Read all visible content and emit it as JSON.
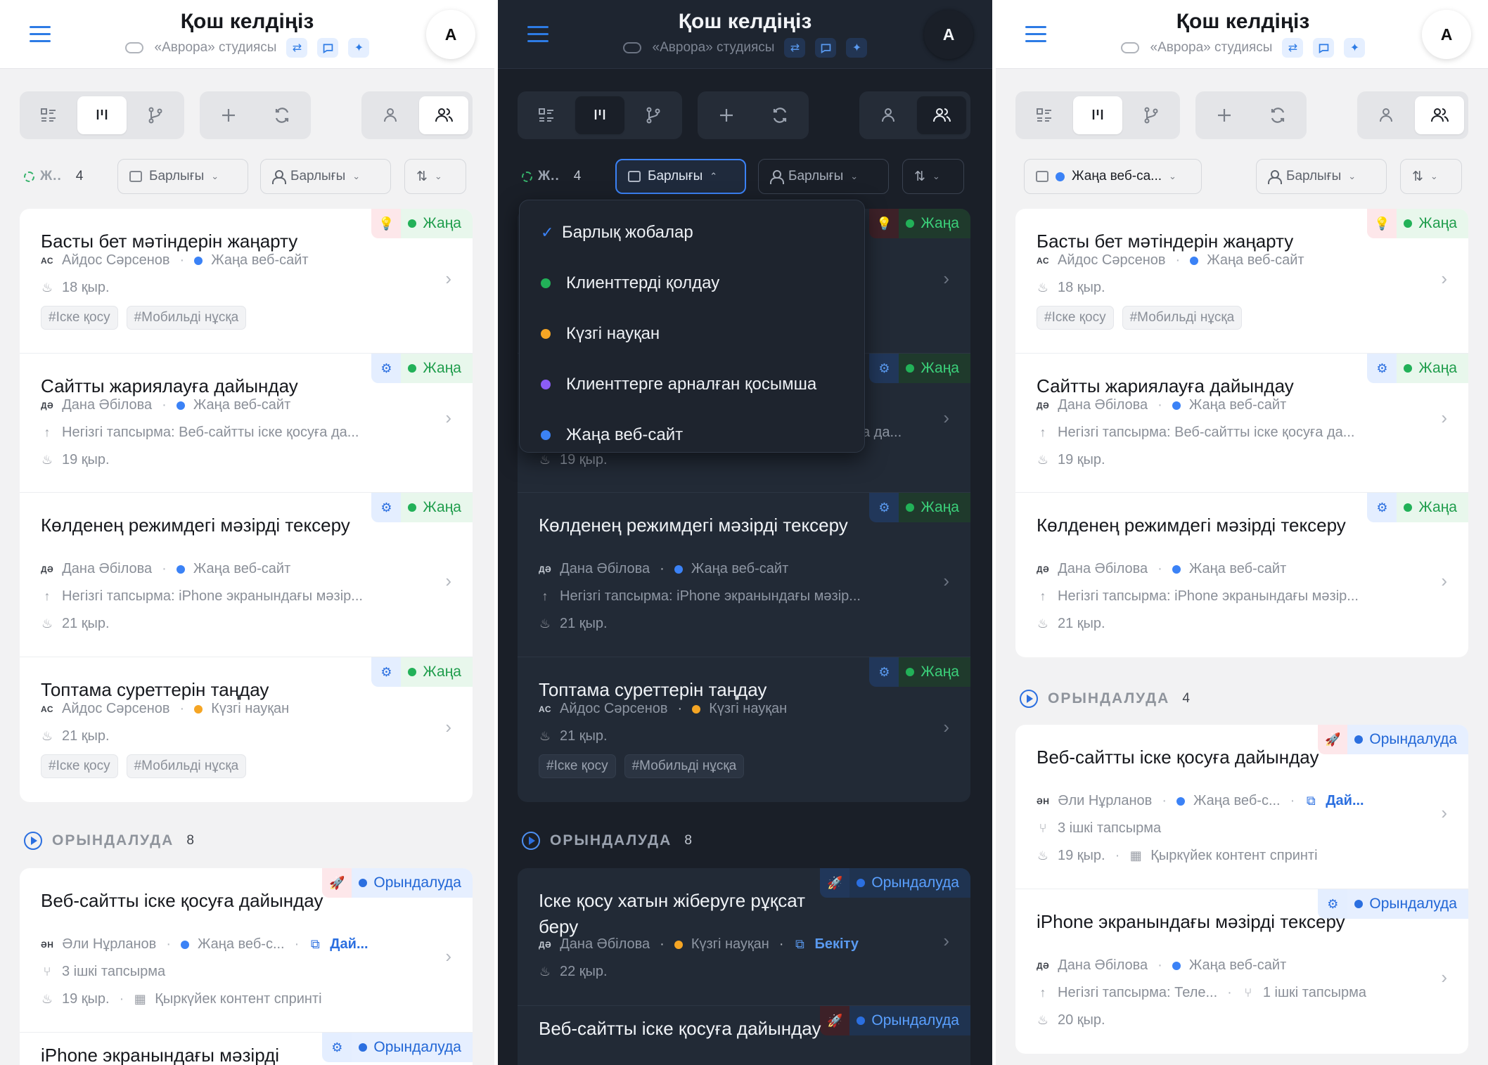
{
  "header": {
    "title": "Қош келдіңіз",
    "subtitle": "«Аврора» студиясы",
    "avatar": "A"
  },
  "status_label": "Ж..",
  "status_count": "4",
  "filters": {
    "project": "Барлығы",
    "assignee": "Барлығы",
    "project_selected": "Жаңа веб-са..."
  },
  "section_progress": {
    "label": "ОРЫНДАЛУДА",
    "count_left": "8",
    "count_right": "4"
  },
  "badges": {
    "new": "Жаңа",
    "progress": "Орындалуда"
  },
  "colors": {
    "accent": "#2d7be5",
    "green": "#22b158",
    "orange": "#f5a524",
    "purple": "#8b5cf6",
    "blue": "#3b82f6"
  },
  "dropdown": {
    "items": [
      "Барлық жобалар",
      "Клиенттерді қолдау",
      "Күзгі науқан",
      "Клиенттерге арналған қосымша",
      "Жаңа веб-сайт"
    ]
  },
  "cards": {
    "c1": {
      "title": "Басты бет мәтіндерін жаңарту",
      "initials": "АС",
      "assignee": "Айдос Сәрсенов",
      "project": "Жаңа веб-сайт",
      "date": "18 қыр.",
      "tags": [
        "#Іске қосу",
        "#Мобильді нұсқа"
      ]
    },
    "c2": {
      "title": "Сайтты жариялауға дайындау",
      "initials": "ДӘ",
      "assignee": "Дана Әбілова",
      "project": "Жаңа веб-сайт",
      "parent": "Негізгі тапсырма: Веб-сайтты іске қосуға да...",
      "date": "19 қыр."
    },
    "c3": {
      "title": "Көлденең режимдегі мәзірді тексеру",
      "initials": "ДӘ",
      "assignee": "Дана Әбілова",
      "project": "Жаңа веб-сайт",
      "parent": "Негізгі тапсырма: iPhone экранындағы мәзір...",
      "date": "21 қыр."
    },
    "c4": {
      "title": "Топтама суреттерін таңдау",
      "initials": "АС",
      "assignee": "Айдос Сәрсенов",
      "project": "Күзгі науқан",
      "date": "21 қыр.",
      "tags": [
        "#Іске қосу",
        "#Мобильді нұсқа"
      ]
    },
    "c5": {
      "title": "Веб-сайтты іске қосуға дайындау",
      "initials": "ӘН",
      "assignee": "Әли Нұрланов",
      "project": "Жаңа веб-с...",
      "link": "Дай...",
      "subtasks": "3 ішкі тапсырма",
      "date": "19 қыр.",
      "sprint": "Қыркүйек контент спринті"
    },
    "c6": {
      "title": "iPhone экранындағы мәзірді тексеру",
      "initials": "ДӘ",
      "assignee": "Дана Әбілова",
      "project": "Жаңа веб-сайт",
      "parent": "Негізгі тапсырма: Теле...",
      "subtasks": "1 ішкі тапсырма",
      "date": "20 қыр."
    },
    "c7": {
      "title": "Іске қосу хатын жіберуге рұқсат беру",
      "initials": "ДӘ",
      "assignee": "Дана Әбілова",
      "project": "Күзгі науқан",
      "link": "Бекіту",
      "date": "22 қыр."
    },
    "c6short": {
      "title": "iPhone экранындағы мәзірді"
    },
    "c2tail": {
      "parent": "а да...",
      "date": "19 қыр."
    }
  }
}
